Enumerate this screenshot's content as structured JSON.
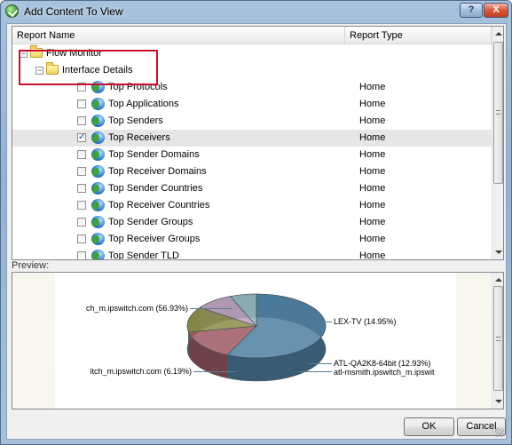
{
  "window": {
    "title": "Add Content To View",
    "help_glyph": "?",
    "close_glyph": "X"
  },
  "grid": {
    "columns": [
      "Report Name",
      "Report Type"
    ],
    "tree": [
      {
        "level": 0,
        "kind": "folder",
        "label": "Flow Monitor",
        "expanded": true
      },
      {
        "level": 1,
        "kind": "folder",
        "label": "Interface Details",
        "expanded": true
      }
    ],
    "reports": [
      {
        "name": "Top Protocols",
        "type": "Home",
        "checked": false
      },
      {
        "name": "Top Applications",
        "type": "Home",
        "checked": false
      },
      {
        "name": "Top Senders",
        "type": "Home",
        "checked": false
      },
      {
        "name": "Top Receivers",
        "type": "Home",
        "checked": true,
        "selected": true
      },
      {
        "name": "Top Sender Domains",
        "type": "Home",
        "checked": false
      },
      {
        "name": "Top Receiver Domains",
        "type": "Home",
        "checked": false
      },
      {
        "name": "Top Sender Countries",
        "type": "Home",
        "checked": false
      },
      {
        "name": "Top Receiver Countries",
        "type": "Home",
        "checked": false
      },
      {
        "name": "Top Sender Groups",
        "type": "Home",
        "checked": false
      },
      {
        "name": "Top Receiver Groups",
        "type": "Home",
        "checked": false
      },
      {
        "name": "Top Sender TLD",
        "type": "Home",
        "checked": false
      }
    ]
  },
  "preview": {
    "label": "Preview:",
    "chart_data": {
      "type": "pie",
      "slices": [
        {
          "label": "ch_m.ipswitch.com (56.93%)",
          "value": 56.93,
          "color": "#4f7fa0"
        },
        {
          "label": "LEX-TV (14.95%)",
          "value": 14.95,
          "color": "#9c5a62"
        },
        {
          "label": "ATL-QA2K8-64bit (12.93%)",
          "value": 12.93,
          "color": "#8a8c4a"
        },
        {
          "label": "atl-msmith.ipswitch_m.ipswit",
          "value": 9.0,
          "color": "#b79fb8"
        },
        {
          "label": "itch_m.ipswitch.com (6.19%)",
          "value": 6.19,
          "color": "#8fb3b8"
        }
      ]
    }
  },
  "buttons": {
    "ok": "OK",
    "cancel": "Cancel"
  }
}
